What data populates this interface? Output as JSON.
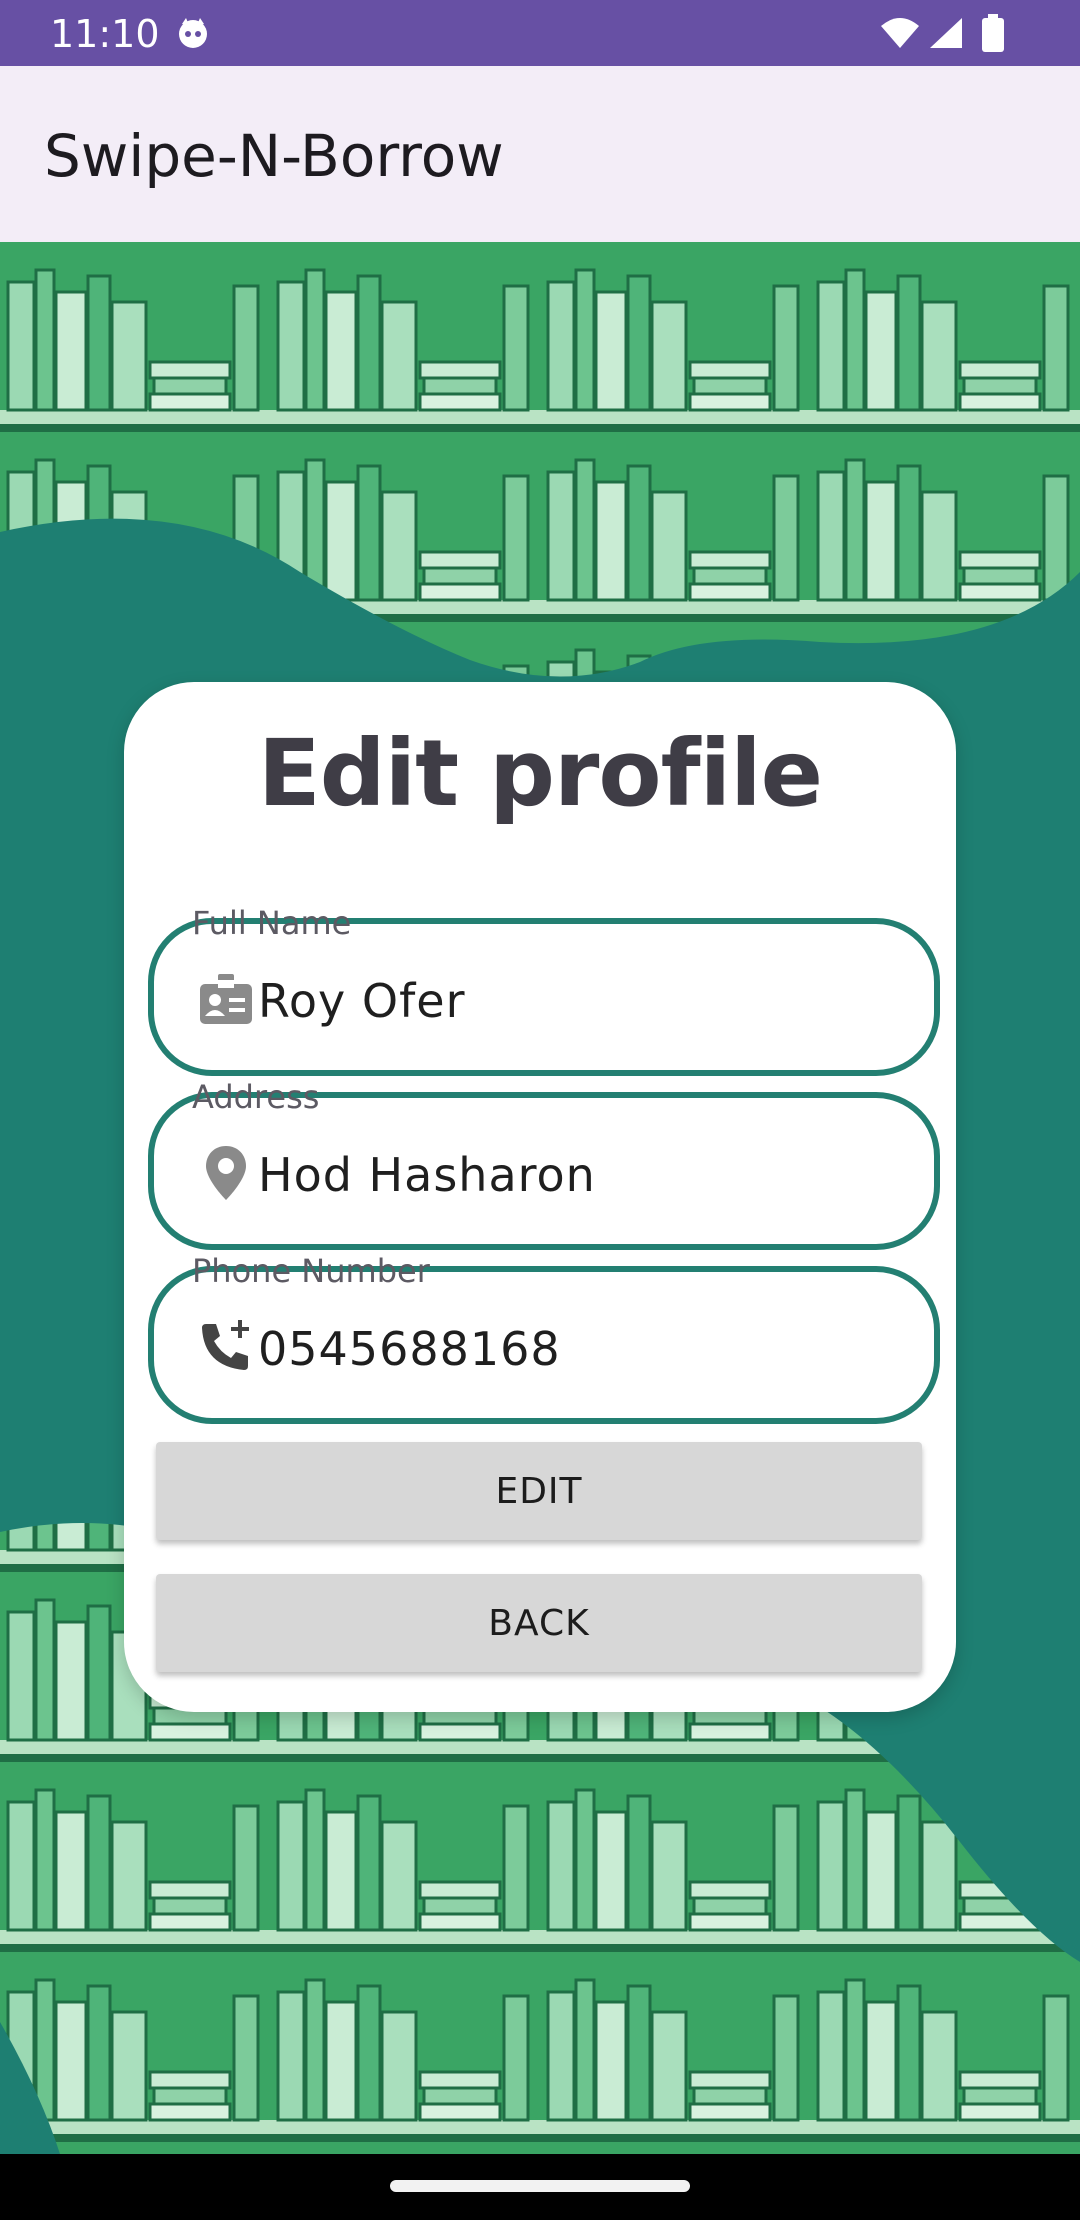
{
  "status_bar": {
    "time": "11:10",
    "icons": [
      "cat-notification-icon",
      "wifi-icon",
      "signal-icon",
      "battery-icon"
    ]
  },
  "app_bar": {
    "title": "Swipe-N-Borrow"
  },
  "colors": {
    "status_bar": "#6750a4",
    "app_bar": "#f3edf7",
    "background_teal": "#1e7f72",
    "field_border": "#237f72",
    "button_bg": "#d7d7d7"
  },
  "card": {
    "title": "Edit profile",
    "fields": [
      {
        "label": "Full Name",
        "value": "Roy Ofer",
        "icon": "badge-icon"
      },
      {
        "label": "Address",
        "value": "Hod Hasharon",
        "icon": "location-pin-icon"
      },
      {
        "label": "Phone Number",
        "value": "0545688168",
        "icon": "add-call-icon"
      }
    ],
    "buttons": {
      "edit": "EDIT",
      "back": "BACK"
    }
  }
}
